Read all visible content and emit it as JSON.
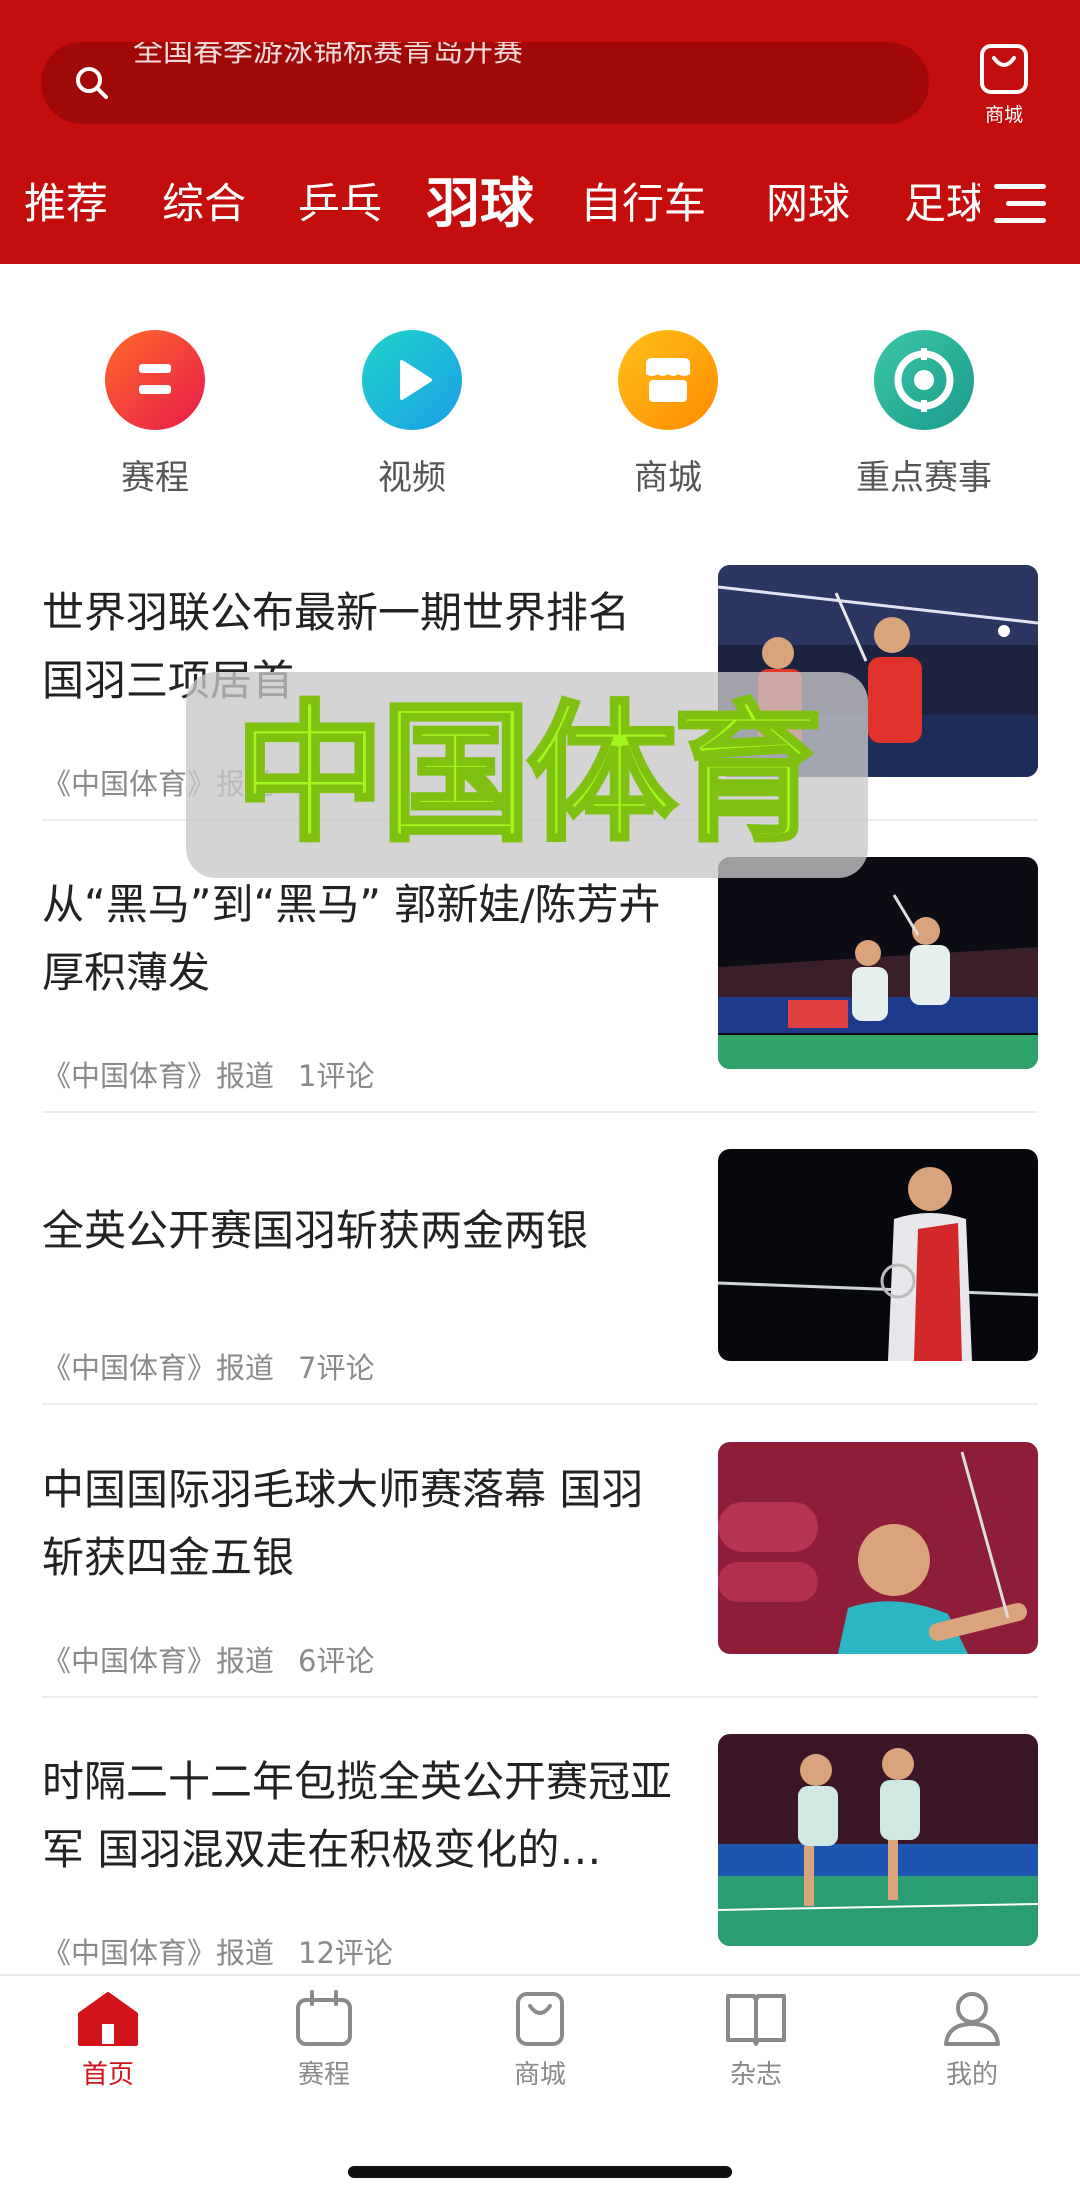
{
  "header": {
    "search_hint": "全国春季游泳锦标赛青岛开赛",
    "shop_label": "商城",
    "tabs": [
      "推荐",
      "综合",
      "乒乓",
      "羽球",
      "自行车",
      "网球",
      "足球"
    ],
    "active_tab": "羽球"
  },
  "quick_links": [
    {
      "label": "赛程",
      "icon": "schedule-icon"
    },
    {
      "label": "视频",
      "icon": "play-icon"
    },
    {
      "label": "商城",
      "icon": "store-icon"
    },
    {
      "label": "重点赛事",
      "icon": "target-icon"
    }
  ],
  "news": [
    {
      "title": "世界羽联公布最新一期世界排名 国羽三项居首",
      "source": "《中国体育》报道",
      "comments": ""
    },
    {
      "title": "从“黑马”到“黑马” 郭新娃/陈芳卉厚积薄发",
      "source": "《中国体育》报道",
      "comments": "1评论"
    },
    {
      "title": "全英公开赛国羽斩获两金两银",
      "source": "《中国体育》报道",
      "comments": "7评论"
    },
    {
      "title": "中国国际羽毛球大师赛落幕 国羽斩获四金五银",
      "source": "《中国体育》报道",
      "comments": "6评论"
    },
    {
      "title": "时隔二十二年包揽全英公开赛冠亚军 国羽混双走在积极变化的…",
      "source": "《中国体育》报道",
      "comments": "12评论"
    }
  ],
  "watermark": "中国体育",
  "bottom_nav": [
    {
      "label": "首页",
      "active": true
    },
    {
      "label": "赛程",
      "active": false
    },
    {
      "label": "商城",
      "active": false
    },
    {
      "label": "杂志",
      "active": false
    },
    {
      "label": "我的",
      "active": false
    }
  ],
  "colors": {
    "brand_red": "#c40d0d",
    "search_bg": "#a10909",
    "active_nav": "#d2131a",
    "watermark_text": "#a5f520"
  }
}
